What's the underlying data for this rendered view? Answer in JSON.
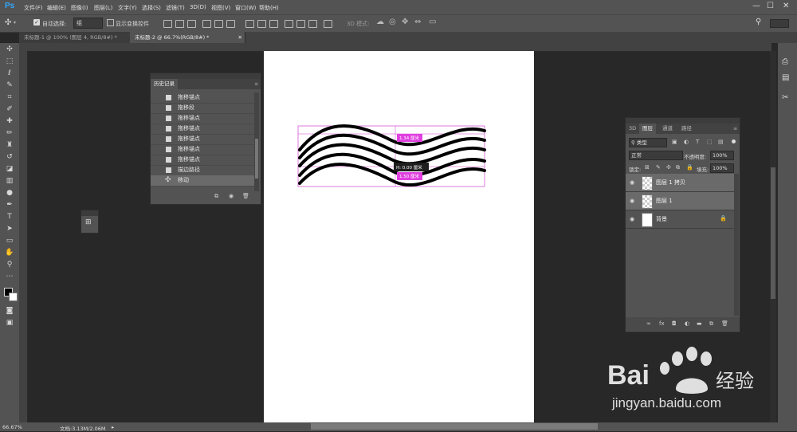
{
  "app": {
    "logo": "Ps"
  },
  "menubar": {
    "items": [
      "文件(F)",
      "编辑(E)",
      "图像(I)",
      "图层(L)",
      "文字(Y)",
      "选择(S)",
      "滤镜(T)",
      "3D(D)",
      "视图(V)",
      "窗口(W)",
      "帮助(H)"
    ],
    "window_controls": [
      "—",
      "☐",
      "✕"
    ]
  },
  "options": {
    "auto_select_label": "自动选择:",
    "auto_select_value": "组",
    "transform_label": "显示变换控件",
    "mode3d_label": "3D 模式:"
  },
  "tabs": [
    {
      "label": "未标题-1 @ 100% (图层 4, RGB/8#) *"
    },
    {
      "label": "未标题-2 @ 66.7%(RGB/8#) *"
    }
  ],
  "history_panel": {
    "title": "历史记录",
    "items": [
      "拖移锚点",
      "拖移段",
      "拖移锚点",
      "拖移锚点",
      "拖移锚点",
      "拖移锚点",
      "拖移锚点",
      "描边路径",
      "移动"
    ],
    "selected_index": 8
  },
  "layers_panel": {
    "tabs": [
      "3D",
      "图层",
      "通道",
      "路径"
    ],
    "active_tab": "图层",
    "filter_label": "类型",
    "blend_mode": "正常",
    "opacity_label": "不透明度:",
    "opacity_value": "100%",
    "lock_label": "锁定:",
    "fill_label": "填充:",
    "fill_value": "100%",
    "layers": [
      {
        "name": "图层 1 拷贝",
        "selected": true
      },
      {
        "name": "图层 1",
        "selected": true
      },
      {
        "name": "背景",
        "selected": false
      }
    ],
    "footer_icons": [
      "link-icon",
      "fx-icon",
      "mask-icon",
      "adjustment-icon",
      "folder-icon",
      "new-layer-icon",
      "trash-icon"
    ]
  },
  "canvas_overlay": {
    "tooltip_dx": "H: 0.00 厘米",
    "tag_top": "1.34 厘米",
    "tag_mid": "1.50 厘米"
  },
  "status": {
    "zoom": "66.67%",
    "doc": "文档:3.13M/2.06M"
  },
  "watermark": {
    "brand": "Bai",
    "brand2": "经验",
    "url": "jingyan.baidu.com"
  }
}
